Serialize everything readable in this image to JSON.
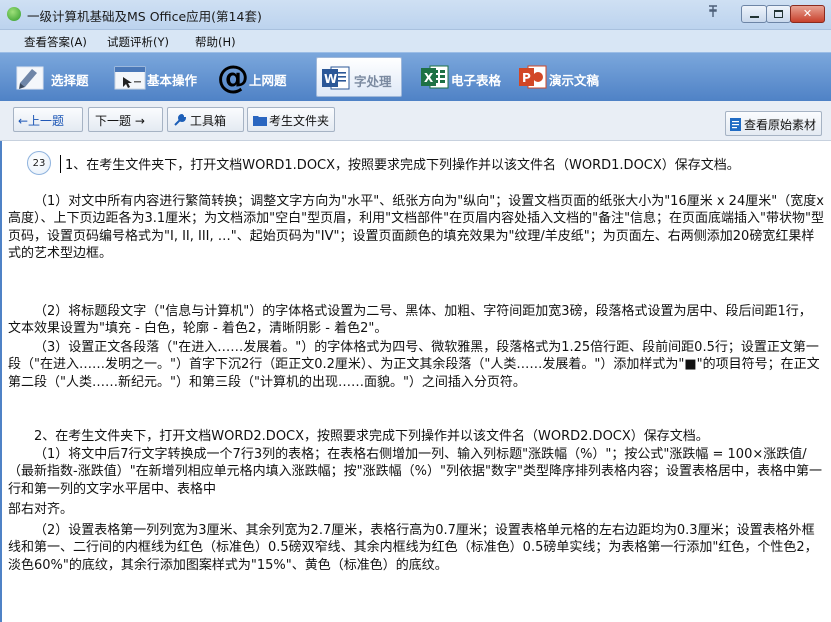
{
  "window": {
    "title": "一级计算机基础及MS Office应用(第14套)",
    "controls": {
      "minimize": "–",
      "maximize": "□",
      "close": "✕"
    },
    "pin_glyph": "ꟷ"
  },
  "menu": {
    "items": [
      {
        "label": "查看答案(A)"
      },
      {
        "label": "试题评析(Y)"
      },
      {
        "label": "帮助(H)"
      }
    ]
  },
  "tabs": [
    {
      "label": "选择题",
      "icon": "choice-icon"
    },
    {
      "label": "基本操作",
      "icon": "basic-ops-icon"
    },
    {
      "label": "上网题",
      "icon": "internet-at-icon"
    },
    {
      "label": "字处理",
      "icon": "word-icon",
      "active": true
    },
    {
      "label": "电子表格",
      "icon": "excel-icon"
    },
    {
      "label": "演示文稿",
      "icon": "powerpoint-icon"
    }
  ],
  "toolbar": {
    "prev": "←上一题",
    "next": "下一题 →",
    "tools": "工具箱",
    "folder": "考生文件夹",
    "view_source": "查看原始素材"
  },
  "content": {
    "badge": "23",
    "paragraphs": [
      "1、在考生文件夹下，打开文档WORD1.DOCX，按照要求完成下列操作并以该文件名（WORD1.DOCX）保存文档。",
      "（1）对文中所有内容进行繁简转换；调整文字方向为\"水平\"、纸张方向为\"纵向\"；设置文档页面的纸张大小为\"16厘米 x 24厘米\"（宽度x高度）、上下页边距各为3.1厘米；为文档添加\"空白\"型页眉，利用\"文档部件\"在页眉内容处插入文档的\"备注\"信息；在页面底端插入\"带状物\"型页码，设置页码编号格式为\"I, II, III, …\"、起始页码为\"IV\"；设置页面颜色的填充效果为\"纹理/羊皮纸\"；为页面左、右两侧添加20磅宽红果样式的艺术型边框。",
      "（2）将标题段文字（\"信息与计算机\"）的字体格式设置为二号、黑体、加粗、字符间距加宽3磅，段落格式设置为居中、段后间距1行，文本效果设置为\"填充 - 白色，轮廓 - 着色2，清晰阴影 - 着色2\"。",
      "（3）设置正文各段落（\"在进入……发展着。\"）的字体格式为四号、微软雅黑，段落格式为1.25倍行距、段前间距0.5行；设置正文第一段（\"在进入……发明之一。\"）首字下沉2行（距正文0.2厘米）、为正文其余段落（\"人类……发展着。\"）添加样式为\"■\"的项目符号；在正文第二段（\"人类……新纪元。\"）和第三段（\"计算机的出现……面貌。\"）之间插入分页符。",
      "2、在考生文件夹下，打开文档WORD2.DOCX，按照要求完成下列操作并以该文件名（WORD2.DOCX）保存文档。",
      "（1）将文中后7行文字转换成一个7行3列的表格；在表格右侧增加一列、输入列标题\"涨跌幅（%）\"；按公式\"涨跌幅 = 100×涨跌值/（最新指数-涨跌值）\"在新增列相应单元格内填入涨跌幅；按\"涨跌幅（%）\"列依据\"数字\"类型降序排列表格内容；设置表格居中，表格中第一行和第一列的文字水平居中、表格中",
      "部右对齐。",
      "（2）设置表格第一列列宽为3厘米、其余列宽为2.7厘米，表格行高为0.7厘米；设置表格单元格的左右边距均为0.3厘米；设置表格外框线和第一、二行间的内框线为红色（标准色）0.5磅双窄线、其余内框线为红色（标准色）0.5磅单实线；为表格第一行添加\"红色，个性色2，淡色60%\"的底纹，其余行添加图案样式为\"15%\"、黄色（标准色）的底纹。"
    ]
  },
  "colors": {
    "tab_bar": "#4f82c6",
    "title_bar": "#c7dbf2",
    "close_button": "#c8412c"
  }
}
